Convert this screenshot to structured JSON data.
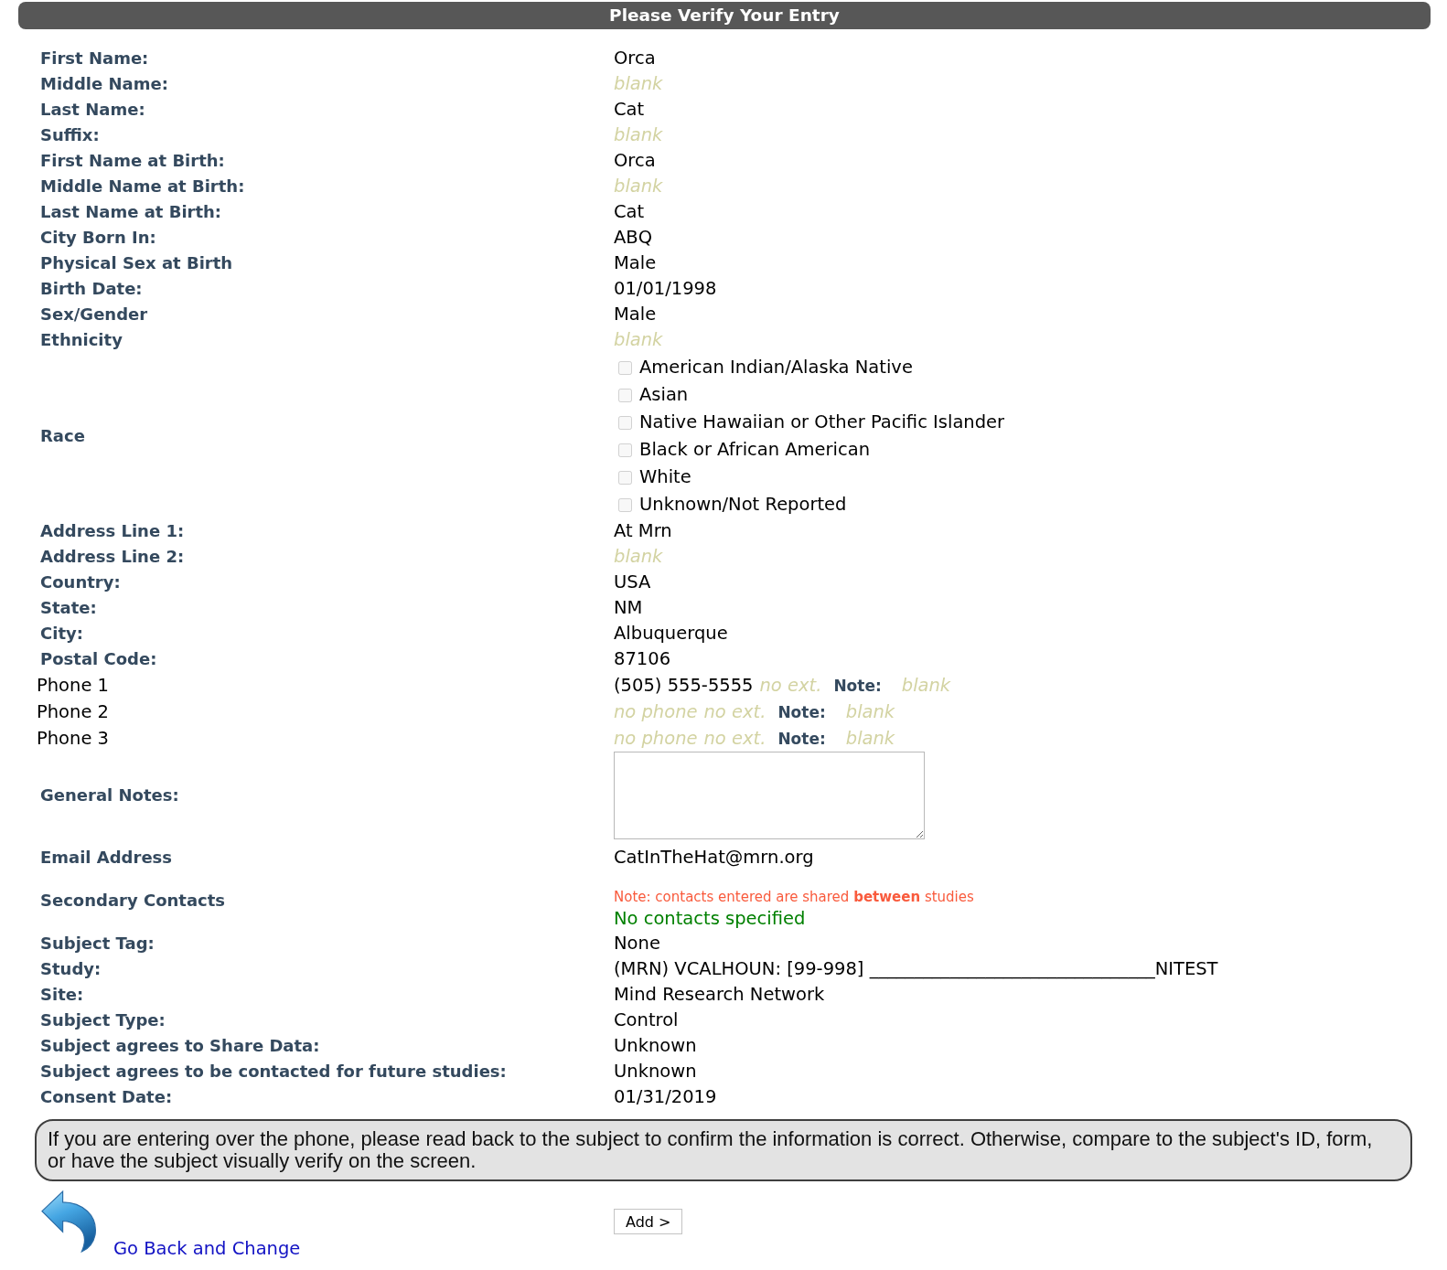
{
  "header": {
    "title": "Please Verify Your Entry"
  },
  "fields": [
    {
      "kind": "text",
      "label": "First Name:",
      "value": "Orca",
      "empty": false
    },
    {
      "kind": "text",
      "label": "Middle Name:",
      "value": "blank",
      "empty": true
    },
    {
      "kind": "text",
      "label": "Last Name:",
      "value": "Cat",
      "empty": false
    },
    {
      "kind": "text",
      "label": "Suffix:",
      "value": "blank",
      "empty": true
    },
    {
      "kind": "text",
      "label": "First Name at Birth:",
      "value": "Orca",
      "empty": false
    },
    {
      "kind": "text",
      "label": "Middle Name at Birth:",
      "value": "blank",
      "empty": true
    },
    {
      "kind": "text",
      "label": "Last Name at Birth:",
      "value": "Cat",
      "empty": false
    },
    {
      "kind": "text",
      "label": "City Born In:",
      "value": "ABQ",
      "empty": false
    },
    {
      "kind": "text",
      "label": "Physical Sex at Birth",
      "value": "Male",
      "empty": false
    },
    {
      "kind": "text",
      "label": "Birth Date:",
      "value": "01/01/1998",
      "empty": false
    },
    {
      "kind": "text",
      "label": "Sex/Gender",
      "value": "Male",
      "empty": false
    },
    {
      "kind": "text",
      "label": "Ethnicity",
      "value": "blank",
      "empty": true
    },
    {
      "kind": "checklist",
      "label": "Race",
      "options": [
        {
          "label": "American Indian/Alaska Native",
          "checked": false
        },
        {
          "label": "Asian",
          "checked": false
        },
        {
          "label": "Native Hawaiian or Other Pacific Islander",
          "checked": false
        },
        {
          "label": "Black or African American",
          "checked": false
        },
        {
          "label": "White",
          "checked": false
        },
        {
          "label": "Unknown/Not Reported",
          "checked": false
        }
      ]
    },
    {
      "kind": "text",
      "label": "Address Line 1:",
      "value": "At Mrn",
      "empty": false
    },
    {
      "kind": "text",
      "label": "Address Line 2:",
      "value": "blank",
      "empty": true
    },
    {
      "kind": "text",
      "label": "Country:",
      "value": "USA",
      "empty": false
    },
    {
      "kind": "text",
      "label": "State:",
      "value": "NM",
      "empty": false
    },
    {
      "kind": "text",
      "label": "City:",
      "value": "Albuquerque",
      "empty": false
    },
    {
      "kind": "text",
      "label": "Postal Code:",
      "value": "87106",
      "empty": false
    },
    {
      "kind": "phone",
      "label": "Phone 1",
      "number": {
        "text": "(505) 555-5555",
        "empty": false
      },
      "ext": {
        "text": "no ext.",
        "empty": true
      },
      "note_label": "Note:",
      "note": {
        "text": "blank",
        "empty": true
      }
    },
    {
      "kind": "phone",
      "label": "Phone 2",
      "number": {
        "text": "no phone",
        "empty": true
      },
      "ext": {
        "text": "no ext.",
        "empty": true
      },
      "note_label": "Note:",
      "note": {
        "text": "blank",
        "empty": true
      }
    },
    {
      "kind": "phone",
      "label": "Phone 3",
      "number": {
        "text": "no phone",
        "empty": true
      },
      "ext": {
        "text": "no ext.",
        "empty": true
      },
      "note_label": "Note:",
      "note": {
        "text": "blank",
        "empty": true
      }
    },
    {
      "kind": "textarea",
      "label": "General Notes:"
    },
    {
      "kind": "text",
      "label": "Email Address",
      "value": "CatInTheHat@mrn.org",
      "empty": false
    },
    {
      "kind": "contacts",
      "label": "Secondary Contacts",
      "note": "Note: contacts entered are shared **between** studies",
      "status": "No contacts specified"
    },
    {
      "kind": "text",
      "label": "Subject Tag:",
      "value": "None",
      "empty": false
    },
    {
      "kind": "text",
      "label": "Study:",
      "value": "(MRN) VCALHOUN: [99-998] ________________________________NITEST",
      "empty": false
    },
    {
      "kind": "text",
      "label": "Site:",
      "value": "Mind Research Network",
      "empty": false
    },
    {
      "kind": "text",
      "label": "Subject Type:",
      "value": "Control",
      "empty": false
    },
    {
      "kind": "text",
      "label": "Subject agrees to Share Data:",
      "value": "Unknown",
      "empty": false
    },
    {
      "kind": "text",
      "label": "Subject agrees to be contacted for future studies:",
      "value": "Unknown",
      "empty": false
    },
    {
      "kind": "text",
      "label": "Consent Date:",
      "value": "01/31/2019",
      "empty": false
    }
  ],
  "instructions": "If you are entering over the phone, please read back to the subject to confirm the information is correct. Otherwise, compare to the subject's ID, form, or have the subject visually verify on the screen.",
  "back_link": "Go Back and Change",
  "add_button": "Add >"
}
